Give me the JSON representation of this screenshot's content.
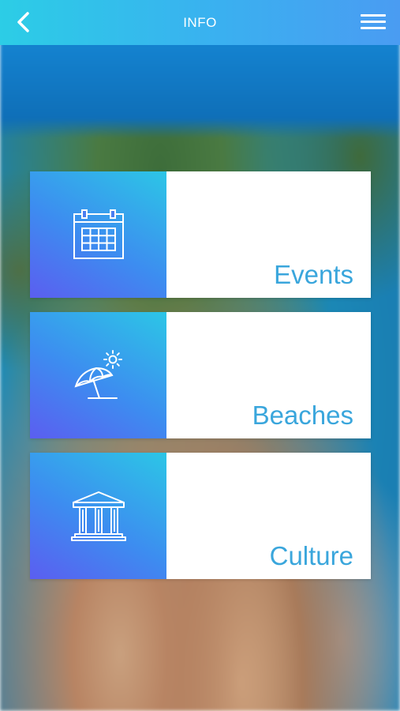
{
  "header": {
    "title": "INFO",
    "back_icon": "chevron-left-icon",
    "menu_icon": "hamburger-menu-icon"
  },
  "cards": [
    {
      "label": "Events",
      "icon": "calendar-icon"
    },
    {
      "label": "Beaches",
      "icon": "beach-umbrella-sun-icon"
    },
    {
      "label": "Culture",
      "icon": "museum-building-icon"
    }
  ],
  "colors": {
    "header_gradient_start": "#2ccde6",
    "header_gradient_end": "#4a9cf2",
    "label_text": "#3aa6dc",
    "icon_gradient_start": "#5b5ef0",
    "icon_gradient_end": "#2cc6e6"
  }
}
